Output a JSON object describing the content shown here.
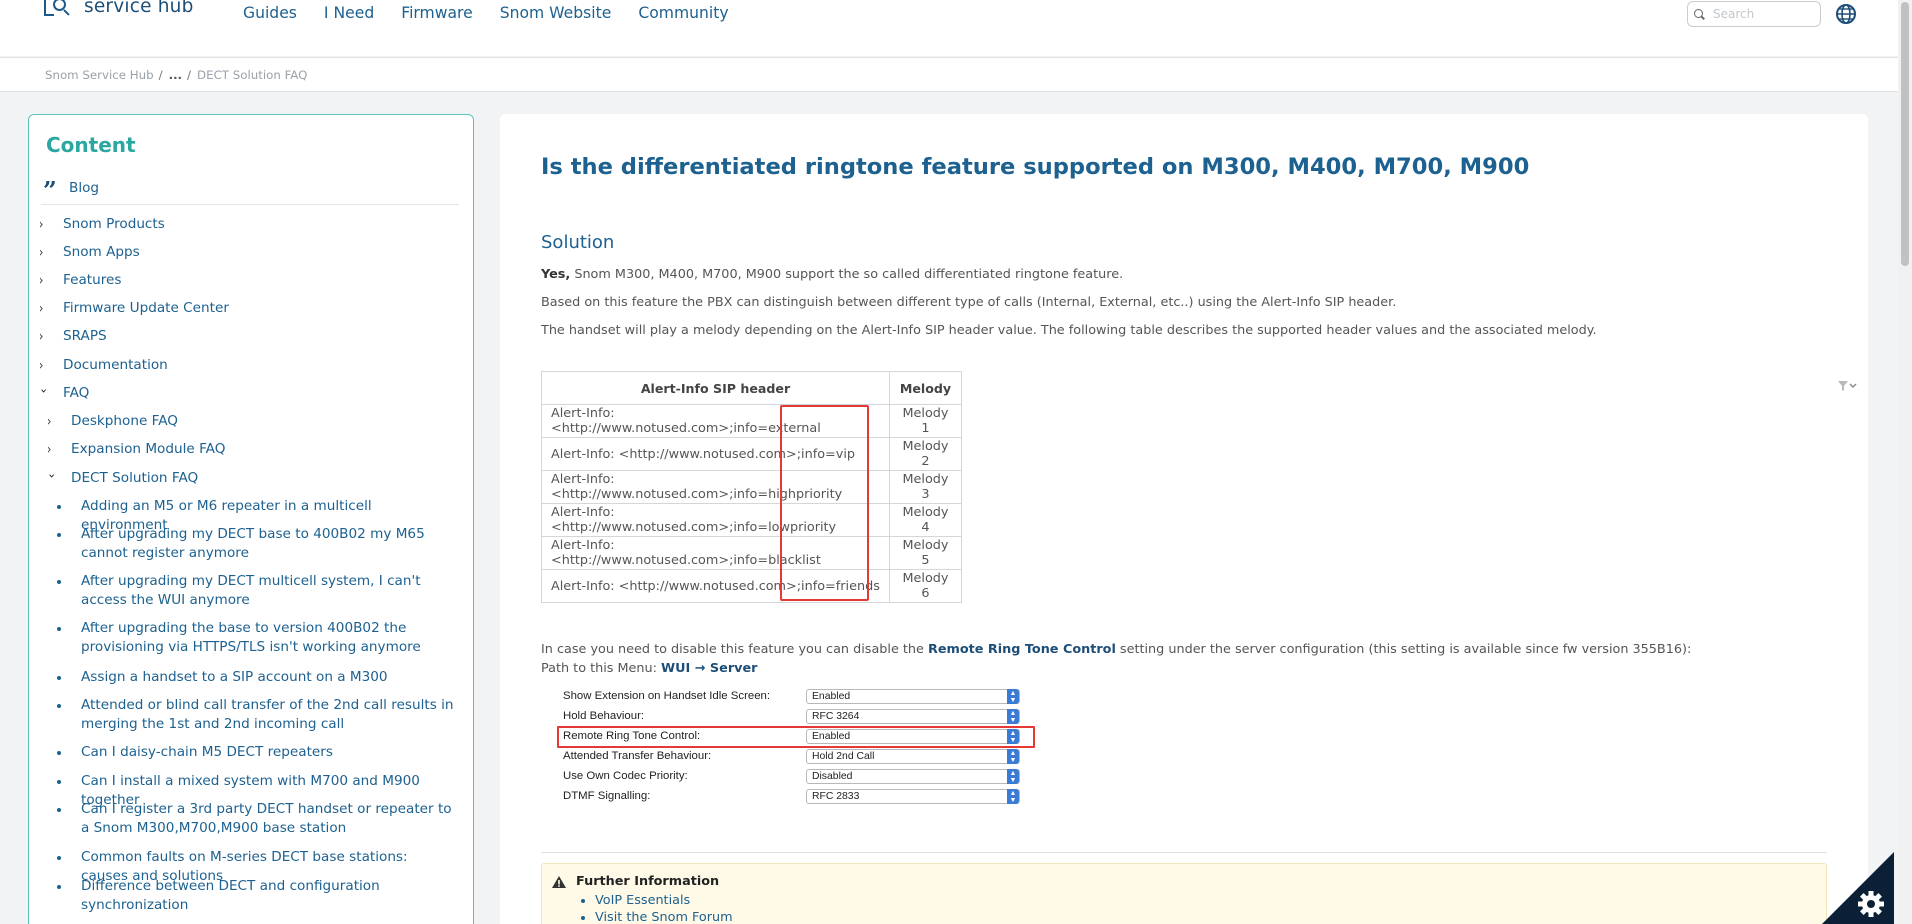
{
  "header": {
    "logo_text": "service hub",
    "nav": [
      "Guides",
      "I Need",
      "Firmware",
      "Snom Website",
      "Community"
    ],
    "search_placeholder": "Search"
  },
  "breadcrumb": {
    "root": "Snom Service Hub",
    "ellipsis": "...",
    "current": "DECT Solution FAQ"
  },
  "sidebar": {
    "title": "Content",
    "blog": "Blog",
    "items": [
      {
        "label": "Snom Products",
        "level": 0,
        "type": "collapsed"
      },
      {
        "label": "Snom Apps",
        "level": 0,
        "type": "collapsed"
      },
      {
        "label": "Features",
        "level": 0,
        "type": "collapsed"
      },
      {
        "label": "Firmware Update Center",
        "level": 0,
        "type": "collapsed"
      },
      {
        "label": "SRAPS",
        "level": 0,
        "type": "collapsed"
      },
      {
        "label": "Documentation",
        "level": 0,
        "type": "collapsed"
      },
      {
        "label": "FAQ",
        "level": 0,
        "type": "expanded"
      },
      {
        "label": "Deskphone FAQ",
        "level": 1,
        "type": "collapsed"
      },
      {
        "label": "Expansion Module FAQ",
        "level": 1,
        "type": "collapsed"
      },
      {
        "label": "DECT Solution FAQ",
        "level": 1,
        "type": "expanded"
      },
      {
        "label": "Adding an M5 or M6 repeater in a multicell environment",
        "level": 2,
        "type": "bullet"
      },
      {
        "label": "After upgrading my DECT base to 400B02 my M65 cannot register anymore",
        "level": 2,
        "type": "bullet"
      },
      {
        "label": "After upgrading my DECT multicell system, I can't access the WUI anymore",
        "level": 2,
        "type": "bullet"
      },
      {
        "label": "After upgrading the base to version 400B02 the provisioning via HTTPS/TLS isn't working anymore",
        "level": 2,
        "type": "bullet"
      },
      {
        "label": "Assign a handset to a SIP account on a M300",
        "level": 2,
        "type": "bullet"
      },
      {
        "label": "Attended or blind call transfer of the 2nd call results in merging the 1st and 2nd incoming call",
        "level": 2,
        "type": "bullet"
      },
      {
        "label": "Can I daisy-chain M5 DECT repeaters",
        "level": 2,
        "type": "bullet"
      },
      {
        "label": "Can I install a mixed system with M700 and M900 together",
        "level": 2,
        "type": "bullet"
      },
      {
        "label": "Can I register a 3rd party DECT handset or repeater to a Snom M300,M700,M900 base station",
        "level": 2,
        "type": "bullet"
      },
      {
        "label": "Common faults on M-series DECT base stations: causes and solutions",
        "level": 2,
        "type": "bullet"
      },
      {
        "label": "Difference between DECT and configuration synchronization",
        "level": 2,
        "type": "bullet"
      }
    ]
  },
  "main": {
    "title": "Is the differentiated ringtone feature supported on M300, M400, M700, M900",
    "solution_heading": "Solution",
    "p1_bold": "Yes,",
    "p1_rest": " Snom M300, M400, M700, M900 support the so called differentiated ringtone feature.",
    "p2": "Based on this feature the PBX can distinguish between different type of calls (Internal, External, etc..) using the Alert-Info SIP header.",
    "p3": "The handset will play a melody depending on the Alert-Info SIP header value. The following table describes the supported header values and the associated melody.",
    "table": {
      "headers": [
        "Alert-Info SIP header",
        "Melody"
      ],
      "rows": [
        [
          "Alert-Info: <http://www.notused.com>;info=external",
          "Melody 1"
        ],
        [
          "Alert-Info: <http://www.notused.com>;info=vip",
          "Melody 2"
        ],
        [
          "Alert-Info: <http://www.notused.com>;info=highpriority",
          "Melody 3"
        ],
        [
          "Alert-Info: <http://www.notused.com>;info=lowpriority",
          "Melody 4"
        ],
        [
          "Alert-Info: <http://www.notused.com>;info=blacklist",
          "Melody 5"
        ],
        [
          "Alert-Info: <http://www.notused.com>;info=friends",
          "Melody 6"
        ]
      ]
    },
    "info_pre": "In case you need to disable this feature you can disable the ",
    "info_link": "Remote Ring Tone Control",
    "info_post": " setting under the server configuration (this setting is available since fw version 355B16):",
    "path_label": "Path to this Menu: ",
    "path_value": "WUI → Server",
    "settings": [
      {
        "label": "Show Extension on Handset Idle Screen:",
        "value": "Enabled"
      },
      {
        "label": "Hold Behaviour:",
        "value": "RFC 3264"
      },
      {
        "label": "Remote Ring Tone Control:",
        "value": "Enabled"
      },
      {
        "label": "Attended Transfer Behaviour:",
        "value": "Hold 2nd Call"
      },
      {
        "label": "Use Own Codec Priority:",
        "value": "Disabled"
      },
      {
        "label": "DTMF Signalling:",
        "value": "RFC 2833"
      }
    ],
    "further_title": "Further Information",
    "further_links": [
      "VoIP Essentials",
      "Visit the Snom Forum"
    ]
  },
  "colors": {
    "brand_blue": "#1d6190",
    "teal": "#2aa7a0",
    "highlight_red": "#e53935"
  }
}
